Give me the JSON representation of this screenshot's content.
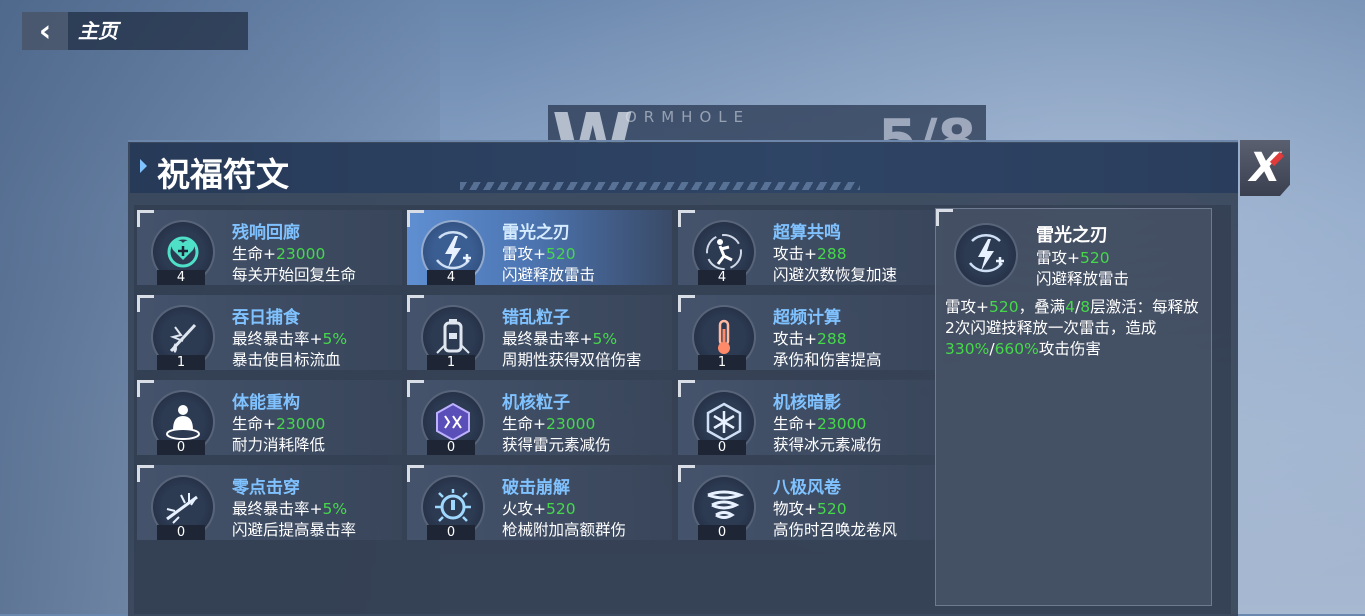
{
  "topbar": {
    "title": "主页"
  },
  "background": {
    "banner_letter": "W",
    "banner_label": "ORMHOLE",
    "progress": "5/8"
  },
  "panel": {
    "title": "祝福符文"
  },
  "cards": [
    {
      "name": "残响回廊",
      "l1_pre": "生命+",
      "l1_val": "23000",
      "l1_post": "",
      "line2": "每关开始回复生命",
      "count": "4",
      "icon": "heart-plus-icon"
    },
    {
      "name": "雷光之刃",
      "l1_pre": "雷攻+",
      "l1_val": "520",
      "l1_post": "",
      "line2": "闪避释放雷击",
      "count": "4",
      "icon": "lightning-shield-icon"
    },
    {
      "name": "超算共鸣",
      "l1_pre": "攻击+",
      "l1_val": "288",
      "l1_post": "",
      "line2": "闪避次数恢复加速",
      "count": "4",
      "icon": "dodge-figure-icon"
    },
    {
      "name": "吞日捕食",
      "l1_pre": "最终暴击率+",
      "l1_val": "5%",
      "l1_post": "",
      "line2": "暴击使目标流血",
      "count": "1",
      "icon": "blood-drop-icon"
    },
    {
      "name": "错乱粒子",
      "l1_pre": "最终暴击率+",
      "l1_val": "5%",
      "l1_post": "",
      "line2": "周期性获得双倍伤害",
      "count": "1",
      "icon": "battery-icon"
    },
    {
      "name": "超频计算",
      "l1_pre": "攻击+",
      "l1_val": "288",
      "l1_post": "",
      "line2": "承伤和伤害提高",
      "count": "1",
      "icon": "thermometer-icon"
    },
    {
      "name": "体能重构",
      "l1_pre": "生命+",
      "l1_val": "23000",
      "l1_post": "",
      "line2": "耐力消耗降低",
      "count": "0",
      "icon": "body-icon"
    },
    {
      "name": "机核粒子",
      "l1_pre": "生命+",
      "l1_val": "23000",
      "l1_post": "",
      "line2": "获得雷元素减伤",
      "count": "0",
      "icon": "thunder-core-icon"
    },
    {
      "name": "机核暗影",
      "l1_pre": "生命+",
      "l1_val": "23000",
      "l1_post": "",
      "line2": "获得冰元素减伤",
      "count": "0",
      "icon": "snowflake-icon"
    },
    {
      "name": "零点击穿",
      "l1_pre": "最终暴击率+",
      "l1_val": "5%",
      "l1_post": "",
      "line2": "闪避后提高暴击率",
      "count": "0",
      "icon": "piercing-strike-icon"
    },
    {
      "name": "破击崩解",
      "l1_pre": "火攻+",
      "l1_val": "520",
      "l1_post": "",
      "line2": "枪械附加高额群伤",
      "count": "0",
      "icon": "burst-icon"
    },
    {
      "name": "八极风卷",
      "l1_pre": "物攻+",
      "l1_val": "520",
      "l1_post": "",
      "line2": "高伤时召唤龙卷风",
      "count": "0",
      "icon": "tornado-icon"
    }
  ],
  "detail": {
    "name": "雷光之刃",
    "l1_pre": "雷攻+",
    "l1_val": "520",
    "line2": "闪避释放雷击",
    "d_a": "雷攻+",
    "d_b": "520",
    "d_c": "，叠满",
    "d_d": "4",
    "d_e": "/",
    "d_f": "8",
    "d_g": "层激活：每释放2次闪避技释放一次雷击，造成",
    "d_h": "330%",
    "d_i": "/",
    "d_j": "660%",
    "d_k": "攻击伤害"
  },
  "colors": {
    "accent_blue": "#7fc2ff",
    "value_green": "#45d94a",
    "close_red": "#e03a3a"
  }
}
